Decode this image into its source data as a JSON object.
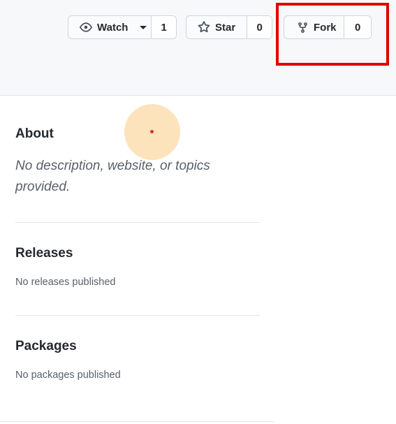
{
  "header": {
    "watch": {
      "label": "Watch",
      "count": "1"
    },
    "star": {
      "label": "Star",
      "count": "0"
    },
    "fork": {
      "label": "Fork",
      "count": "0"
    }
  },
  "sidebar": {
    "about": {
      "title": "About",
      "description": "No description, website, or topics provided."
    },
    "releases": {
      "title": "Releases",
      "text": "No releases published"
    },
    "packages": {
      "title": "Packages",
      "text": "No packages published"
    }
  },
  "icons": {
    "watch": "eye-icon",
    "star": "star-icon",
    "fork": "repo-forked-icon",
    "caret": "triangle-down-icon"
  },
  "colors": {
    "highlight": "#e00000",
    "header_bg": "#f6f8fa",
    "border": "#d1d5da",
    "muted_text": "#586069"
  }
}
